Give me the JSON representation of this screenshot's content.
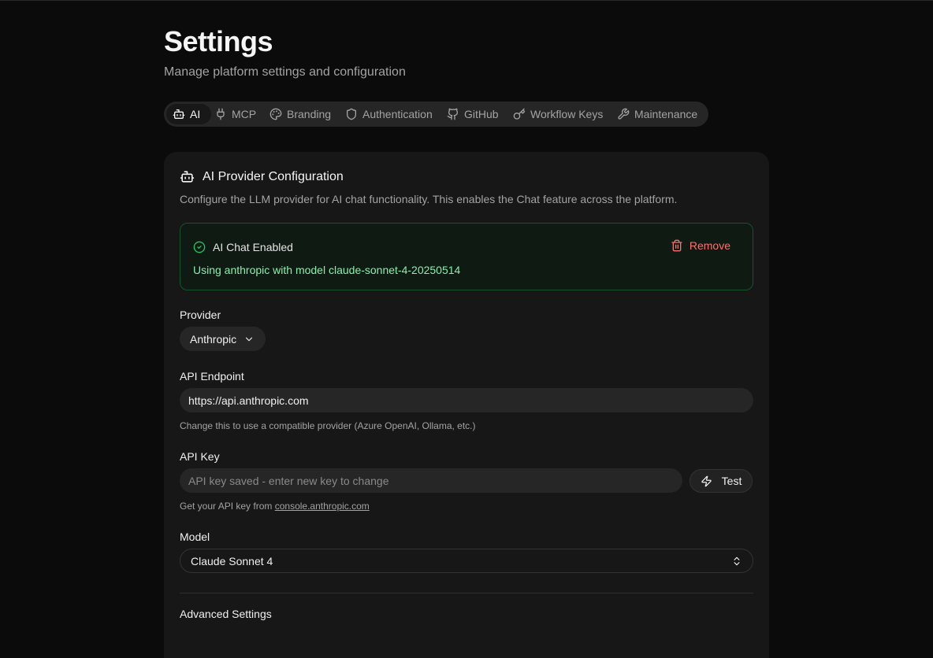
{
  "page": {
    "title": "Settings",
    "subtitle": "Manage platform settings and configuration"
  },
  "tabs": [
    {
      "label": "AI",
      "icon": "bot-icon",
      "active": true
    },
    {
      "label": "MCP",
      "icon": "plug-icon"
    },
    {
      "label": "Branding",
      "icon": "palette-icon"
    },
    {
      "label": "Authentication",
      "icon": "shield-icon"
    },
    {
      "label": "GitHub",
      "icon": "github-icon"
    },
    {
      "label": "Workflow Keys",
      "icon": "key-icon"
    },
    {
      "label": "Maintenance",
      "icon": "wrench-icon"
    }
  ],
  "card": {
    "title": "AI Provider Configuration",
    "description": "Configure the LLM provider for AI chat functionality. This enables the Chat feature across the platform."
  },
  "status": {
    "heading": "AI Chat Enabled",
    "detail": "Using anthropic with model claude-sonnet-4-20250514",
    "remove_label": "Remove",
    "colors": {
      "border": "#14532d",
      "text": "#86efac",
      "danger": "#f87171"
    }
  },
  "provider": {
    "label": "Provider",
    "value": "Anthropic"
  },
  "endpoint": {
    "label": "API Endpoint",
    "value": "https://api.anthropic.com",
    "hint": "Change this to use a compatible provider (Azure OpenAI, Ollama, etc.)"
  },
  "api_key": {
    "label": "API Key",
    "value": "",
    "placeholder": "API key saved - enter new key to change",
    "test_label": "Test",
    "hint_prefix": "Get your API key from ",
    "hint_link": "console.anthropic.com"
  },
  "model": {
    "label": "Model",
    "value": "Claude Sonnet 4"
  },
  "advanced": {
    "label": "Advanced Settings"
  }
}
